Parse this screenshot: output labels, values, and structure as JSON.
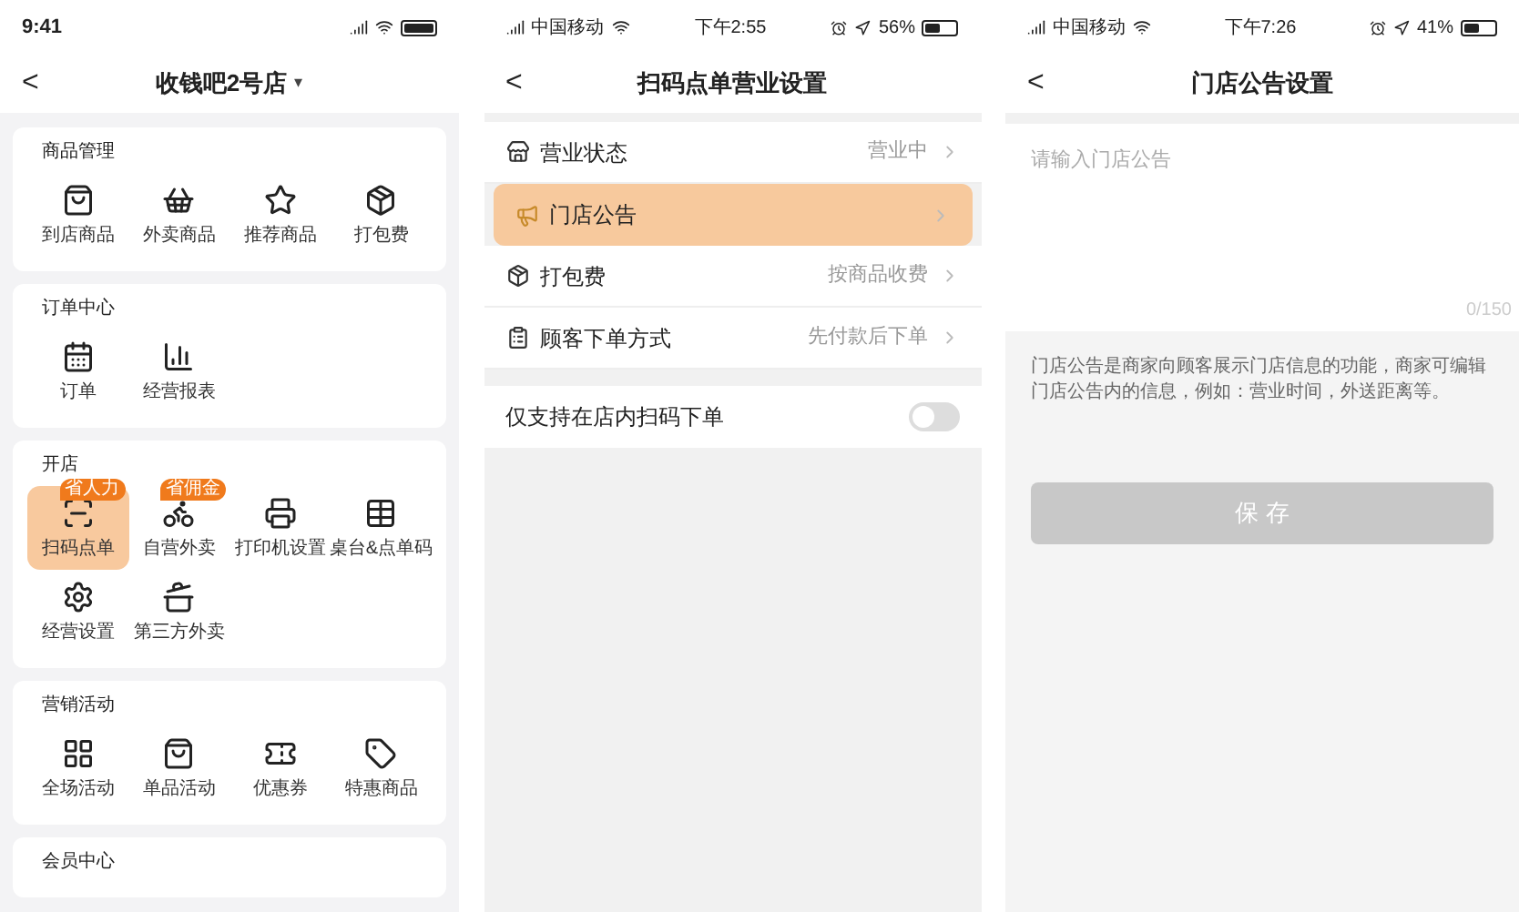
{
  "screens": [
    {
      "kind": "menu",
      "status_bar": {
        "time": "9:41"
      },
      "nav": {
        "back": "<",
        "title": "收钱吧2号店",
        "dropdown": "▾"
      },
      "sections": [
        {
          "title": "商品管理",
          "items": [
            {
              "label": "到店商品",
              "selected": false
            },
            {
              "label": "外卖商品",
              "selected": false
            },
            {
              "label": "推荐商品",
              "selected": false
            },
            {
              "label": "打包费",
              "selected": false
            }
          ]
        },
        {
          "title": "订单中心",
          "items": [
            {
              "label": "订单",
              "selected": false
            },
            {
              "label": "经营报表",
              "selected": false
            }
          ]
        },
        {
          "title": "开店",
          "items": [
            {
              "label": "扫码点单",
              "badge": "省人力",
              "selected": true
            },
            {
              "label": "自营外卖",
              "badge": "省佣金",
              "selected": false
            },
            {
              "label": "打印机设置",
              "selected": false
            },
            {
              "label": "桌台&点单码",
              "selected": false
            },
            {
              "label": "经营设置",
              "selected": false
            },
            {
              "label": "第三方外卖",
              "selected": false
            }
          ]
        },
        {
          "title": "营销活动",
          "items": [
            {
              "label": "全场活动",
              "selected": false
            },
            {
              "label": "单品活动",
              "selected": false
            },
            {
              "label": "优惠券",
              "selected": false
            },
            {
              "label": "特惠商品",
              "selected": false
            }
          ]
        },
        {
          "title": "会员中心"
        }
      ]
    },
    {
      "kind": "settings",
      "status_bar": {
        "carrier": "中国移动",
        "time": "下午2:55",
        "battery_text": "56%"
      },
      "nav": {
        "back": "<",
        "title": "扫码点单营业设置"
      },
      "rows": [
        {
          "kind": "link",
          "label": "营业状态",
          "value": "营业中",
          "selected": false
        },
        {
          "kind": "link",
          "label": "门店公告",
          "selected": true
        },
        {
          "kind": "link",
          "label": "打包费",
          "value": "按商品收费",
          "selected": false
        },
        {
          "kind": "link",
          "label": "顾客下单方式",
          "value": "先付款后下单",
          "selected": false
        },
        {
          "kind": "toggle",
          "label": "仅支持在店内扫码下单",
          "on": false
        }
      ]
    },
    {
      "kind": "notice",
      "status_bar": {
        "carrier": "中国移动",
        "time": "下午7:26",
        "battery_text": "41%"
      },
      "nav": {
        "back": "<",
        "title": "门店公告设置"
      },
      "field": {
        "placeholder": "请输入门店公告",
        "counter": "0/150"
      },
      "note": "门店公告是商家向顾客展示门店信息的功能，商家可编辑门店公告内的信息，例如：营业时间，外送距离等。",
      "save_button": {
        "label": "保 存",
        "disabled": true
      }
    }
  ]
}
